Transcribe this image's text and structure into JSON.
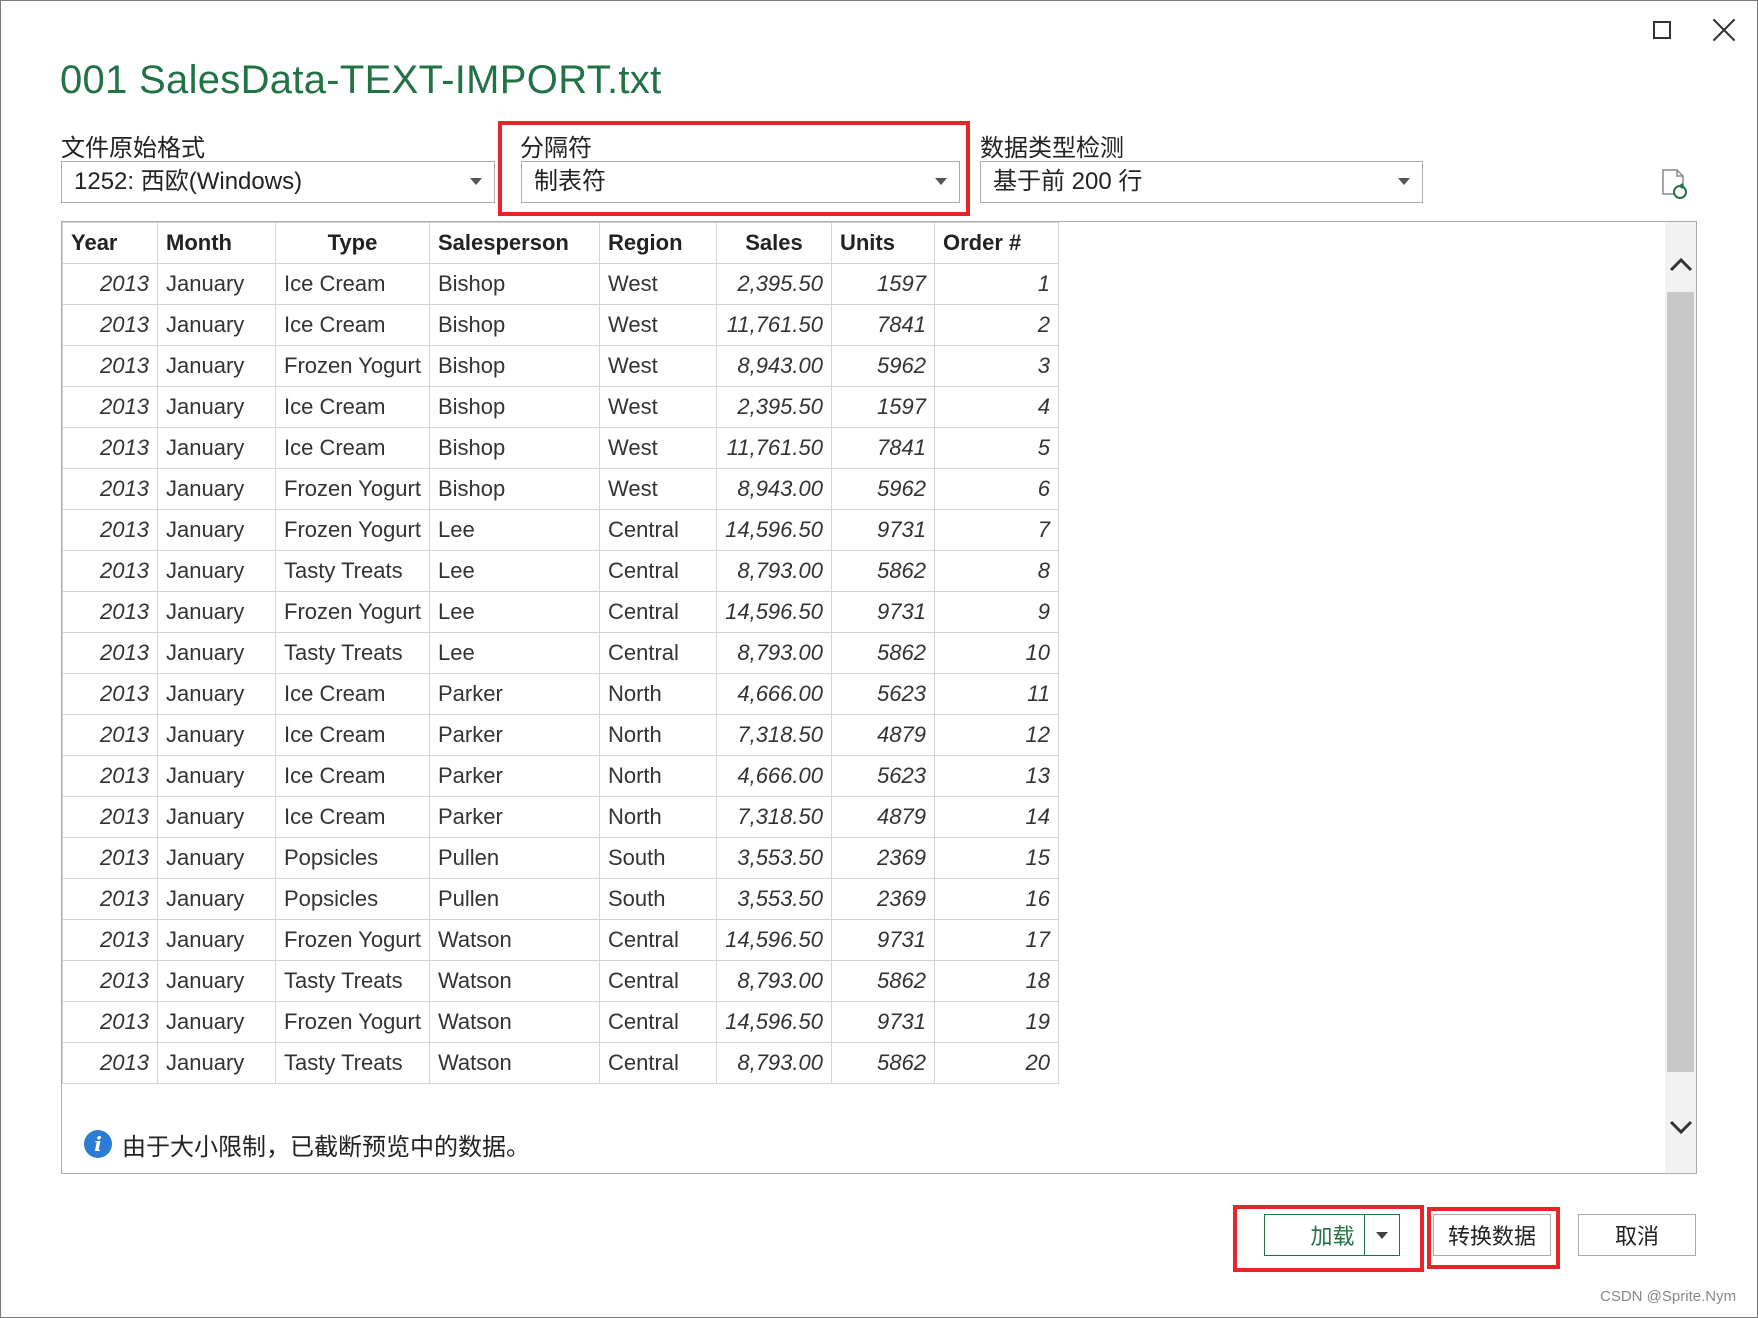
{
  "window": {
    "title": "001 SalesData-TEXT-IMPORT.txt"
  },
  "options": {
    "file_origin": {
      "label": "文件原始格式",
      "value": "1252: 西欧(Windows)"
    },
    "delimiter": {
      "label": "分隔符",
      "value": "制表符"
    },
    "type_detection": {
      "label": "数据类型检测",
      "value": "基于前 200 行"
    }
  },
  "table": {
    "headers": [
      "Year",
      "Month",
      "Type",
      "Salesperson",
      "Region",
      "Sales",
      "Units",
      "Order #"
    ],
    "rows": [
      [
        "2013",
        "January",
        "Ice Cream",
        "Bishop",
        "West",
        "2,395.50",
        "1597",
        "1"
      ],
      [
        "2013",
        "January",
        "Ice Cream",
        "Bishop",
        "West",
        "11,761.50",
        "7841",
        "2"
      ],
      [
        "2013",
        "January",
        "Frozen Yogurt",
        "Bishop",
        "West",
        "8,943.00",
        "5962",
        "3"
      ],
      [
        "2013",
        "January",
        "Ice Cream",
        "Bishop",
        "West",
        "2,395.50",
        "1597",
        "4"
      ],
      [
        "2013",
        "January",
        "Ice Cream",
        "Bishop",
        "West",
        "11,761.50",
        "7841",
        "5"
      ],
      [
        "2013",
        "January",
        "Frozen Yogurt",
        "Bishop",
        "West",
        "8,943.00",
        "5962",
        "6"
      ],
      [
        "2013",
        "January",
        "Frozen Yogurt",
        "Lee",
        "Central",
        "14,596.50",
        "9731",
        "7"
      ],
      [
        "2013",
        "January",
        "Tasty Treats",
        "Lee",
        "Central",
        "8,793.00",
        "5862",
        "8"
      ],
      [
        "2013",
        "January",
        "Frozen Yogurt",
        "Lee",
        "Central",
        "14,596.50",
        "9731",
        "9"
      ],
      [
        "2013",
        "January",
        "Tasty Treats",
        "Lee",
        "Central",
        "8,793.00",
        "5862",
        "10"
      ],
      [
        "2013",
        "January",
        "Ice Cream",
        "Parker",
        "North",
        "4,666.00",
        "5623",
        "11"
      ],
      [
        "2013",
        "January",
        "Ice Cream",
        "Parker",
        "North",
        "7,318.50",
        "4879",
        "12"
      ],
      [
        "2013",
        "January",
        "Ice Cream",
        "Parker",
        "North",
        "4,666.00",
        "5623",
        "13"
      ],
      [
        "2013",
        "January",
        "Ice Cream",
        "Parker",
        "North",
        "7,318.50",
        "4879",
        "14"
      ],
      [
        "2013",
        "January",
        "Popsicles",
        "Pullen",
        "South",
        "3,553.50",
        "2369",
        "15"
      ],
      [
        "2013",
        "January",
        "Popsicles",
        "Pullen",
        "South",
        "3,553.50",
        "2369",
        "16"
      ],
      [
        "2013",
        "January",
        "Frozen Yogurt",
        "Watson",
        "Central",
        "14,596.50",
        "9731",
        "17"
      ],
      [
        "2013",
        "January",
        "Tasty Treats",
        "Watson",
        "Central",
        "8,793.00",
        "5862",
        "18"
      ],
      [
        "2013",
        "January",
        "Frozen Yogurt",
        "Watson",
        "Central",
        "14,596.50",
        "9731",
        "19"
      ],
      [
        "2013",
        "January",
        "Tasty Treats",
        "Watson",
        "Central",
        "8,793.00",
        "5862",
        "20"
      ]
    ]
  },
  "notice": {
    "icon": "info-icon",
    "text": "由于大小限制，已截断预览中的数据。"
  },
  "buttons": {
    "load": "加载",
    "transform": "转换数据",
    "cancel": "取消"
  },
  "watermark": "CSDN @Sprite.Nym",
  "colors": {
    "accent": "#217346",
    "highlight": "#e8242b",
    "info": "#2b7cd3"
  }
}
